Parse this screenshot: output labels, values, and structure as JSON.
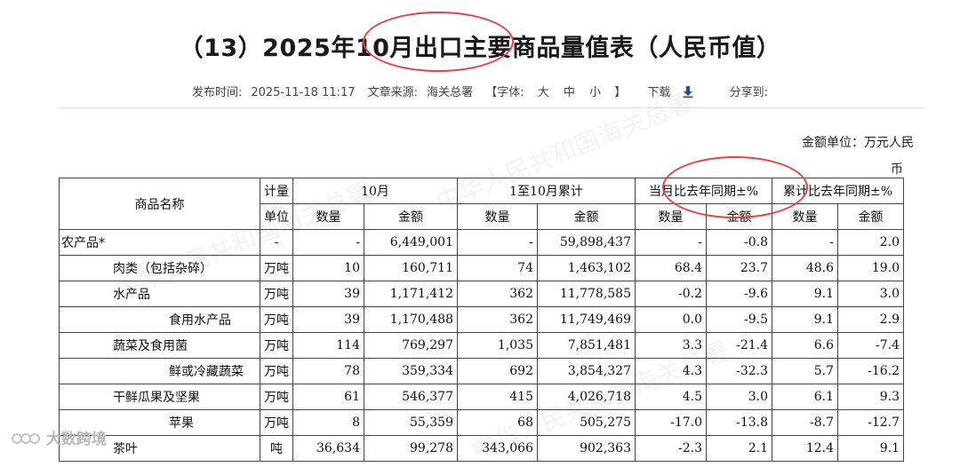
{
  "title": "（13）2025年10月出口主要商品量值表（人民币值）",
  "meta": {
    "publish_label": "发布时间:",
    "publish_time": "2025-11-18 11:17",
    "source_label": "文章来源:",
    "source": "海关总署",
    "font_label": "【字体:",
    "font_large": "大",
    "font_medium": "中",
    "font_small": "小",
    "font_close": "】",
    "download": "下载",
    "share": "分享到:"
  },
  "unit_line1": "金额单位：万元人民",
  "unit_line2": "币",
  "header": {
    "name": "商品名称",
    "unit_top": "计量",
    "unit_bottom": "单位",
    "month": "10月",
    "ytd": "1至10月累计",
    "month_yoy": "当月比去年同期±%",
    "ytd_yoy": "累计比去年同期±%",
    "qty": "数量",
    "amt": "金额"
  },
  "rows": [
    {
      "name": "农产品*",
      "unit": "-",
      "q1": "-",
      "a1": "6,449,001",
      "q2": "-",
      "a2": "59,898,437",
      "q3": "-",
      "a3": "-0.8",
      "q4": "-",
      "a4": "2.0"
    },
    {
      "name": "肉类（包括杂碎）",
      "unit": "万吨",
      "q1": "10",
      "a1": "160,711",
      "q2": "74",
      "a2": "1,463,102",
      "q3": "68.4",
      "a3": "23.7",
      "q4": "48.6",
      "a4": "19.0"
    },
    {
      "name": "水产品",
      "unit": "万吨",
      "q1": "39",
      "a1": "1,171,412",
      "q2": "362",
      "a2": "11,778,585",
      "q3": "-0.2",
      "a3": "-9.6",
      "q4": "9.1",
      "a4": "3.0"
    },
    {
      "name": "食用水产品",
      "unit": "万吨",
      "q1": "39",
      "a1": "1,170,488",
      "q2": "362",
      "a2": "11,749,469",
      "q3": "0.0",
      "a3": "-9.5",
      "q4": "9.1",
      "a4": "2.9"
    },
    {
      "name": "蔬菜及食用菌",
      "unit": "万吨",
      "q1": "114",
      "a1": "769,297",
      "q2": "1,035",
      "a2": "7,851,481",
      "q3": "3.3",
      "a3": "-21.4",
      "q4": "6.6",
      "a4": "-7.4"
    },
    {
      "name": "鲜或冷藏蔬菜",
      "unit": "万吨",
      "q1": "78",
      "a1": "359,334",
      "q2": "692",
      "a2": "3,854,327",
      "q3": "4.3",
      "a3": "-32.3",
      "q4": "5.7",
      "a4": "-16.2"
    },
    {
      "name": "干鲜瓜果及坚果",
      "unit": "万吨",
      "q1": "61",
      "a1": "546,377",
      "q2": "415",
      "a2": "4,026,718",
      "q3": "4.5",
      "a3": "3.0",
      "q4": "6.1",
      "a4": "9.3"
    },
    {
      "name": "苹果",
      "unit": "万吨",
      "q1": "8",
      "a1": "55,359",
      "q2": "68",
      "a2": "505,275",
      "q3": "-17.0",
      "a3": "-13.8",
      "q4": "-8.7",
      "a4": "-12.7"
    },
    {
      "name": "茶叶",
      "unit": "吨",
      "q1": "36,634",
      "a1": "99,278",
      "q2": "343,066",
      "a2": "902,363",
      "q3": "-2.3",
      "a3": "2.1",
      "q4": "12.4",
      "a4": "9.1"
    }
  ],
  "watermark": "大数跨境",
  "annotation_color": "#e54343"
}
